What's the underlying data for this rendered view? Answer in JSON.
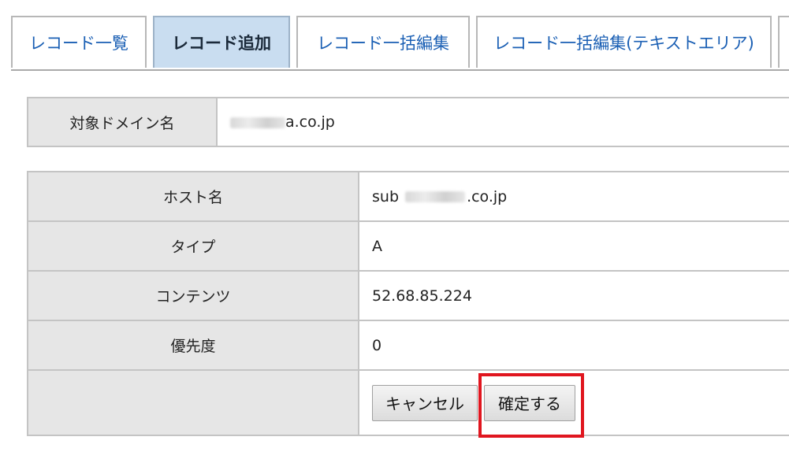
{
  "tabs": [
    {
      "label": "レコード一覧",
      "active": false
    },
    {
      "label": "レコード追加",
      "active": true
    },
    {
      "label": "レコード一括編集",
      "active": false
    },
    {
      "label": "レコード一括編集(テキストエリア)",
      "active": false
    },
    {
      "label": "",
      "active": false
    }
  ],
  "domain": {
    "label": "対象ドメイン名",
    "value_suffix": "a.co.jp"
  },
  "record": {
    "host": {
      "label": "ホスト名",
      "value_prefix": "sub",
      "value_suffix": ".co.jp"
    },
    "type": {
      "label": "タイプ",
      "value": "A"
    },
    "content": {
      "label": "コンテンツ",
      "value": "52.68.85.224"
    },
    "priority": {
      "label": "優先度",
      "value": "0"
    }
  },
  "actions": {
    "cancel_label": "キャンセル",
    "confirm_label": "確定する"
  },
  "colors": {
    "active_tab_bg": "#c9ddf0",
    "tab_text": "#1a5fb4",
    "highlight": "#e0161f",
    "label_bg": "#e6e6e6"
  }
}
